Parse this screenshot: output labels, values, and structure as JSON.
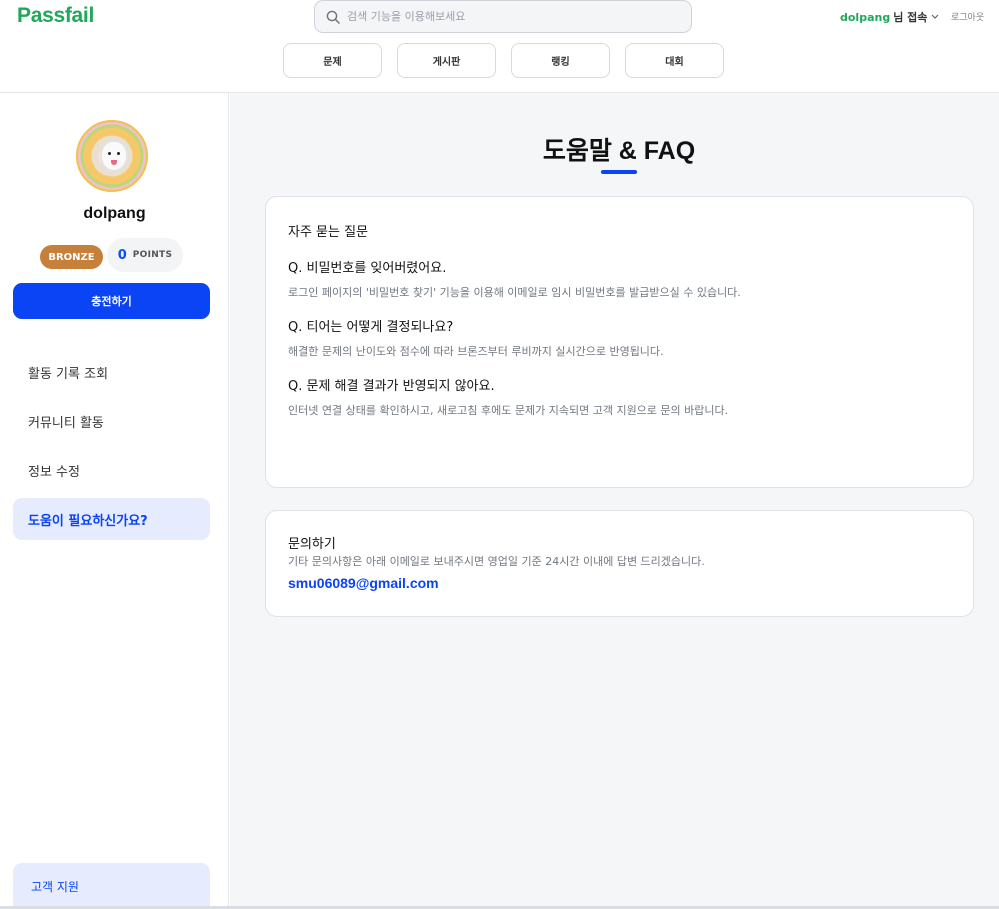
{
  "header": {
    "logo": "Passfail",
    "search": {
      "placeholder": "검색 기능을 이용해보세요"
    },
    "user": {
      "name": "dolpang",
      "suffix": "님 접속"
    },
    "logout": "로그아웃",
    "nav": [
      "문제",
      "게시판",
      "랭킹",
      "대회"
    ]
  },
  "sidebar": {
    "profile_name": "dolpang",
    "tier": "BRONZE",
    "points_value": "0",
    "points_label": "POINTS",
    "charge_label": "충전하기",
    "menu": [
      "활동 기록 조회",
      "커뮤니티 활동",
      "정보 수정",
      "도움이 필요하신가요?"
    ],
    "support_label": "고객 지원"
  },
  "main": {
    "title": "도움말 & FAQ",
    "faq": {
      "section_title": "자주 묻는 질문",
      "items": [
        {
          "q": "Q. 비밀번호를 잊어버렸어요.",
          "a": "로그인 페이지의 '비밀번호 찾기' 기능을 이용해 이메일로 임시 비밀번호를 발급받으실 수 있습니다."
        },
        {
          "q": "Q. 티어는 어떻게 결정되나요?",
          "a": "해결한 문제의 난이도와 점수에 따라 브론즈부터 루비까지 실시간으로 반영됩니다."
        },
        {
          "q": "Q. 문제 해결 결과가 반영되지 않아요.",
          "a": "인터넷 연결 상태를 확인하시고, 새로고침 후에도 문제가 지속되면 고객 지원으로 문의 바랍니다."
        }
      ]
    },
    "contact": {
      "title": "문의하기",
      "desc": "기타 문의사항은 아래 이메일로 보내주시면 영업일 기준 24시간 이내에 답변 드리겠습니다.",
      "email": "smu06089@gmail.com"
    }
  },
  "colors": {
    "brand_green": "#1fa85a",
    "accent_blue": "#0b44f5",
    "tier_bronze": "#c6803a"
  }
}
